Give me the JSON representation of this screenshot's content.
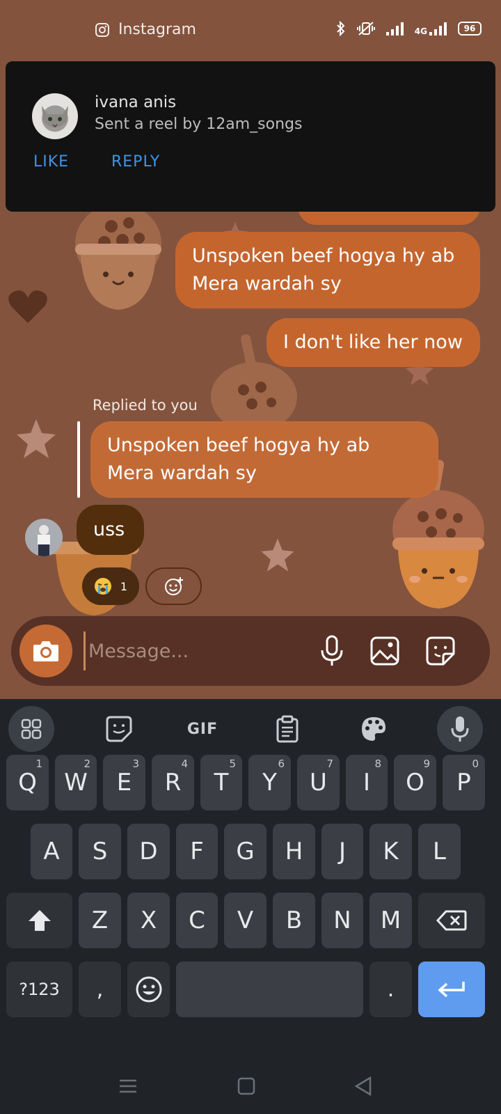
{
  "status_bar": {
    "app_name": "Instagram",
    "network_label": "4G",
    "battery_level": "96"
  },
  "notification": {
    "sender_name": "ivana anis",
    "message": "Sent a reel by 12am_songs",
    "like_label": "LIKE",
    "reply_label": "REPLY"
  },
  "messages": {
    "outgoing_1": "Unspoken beef hogya hy ab Mera wardah sy",
    "outgoing_2": "I don't like her now",
    "reply_context_label": "Replied to you",
    "quoted_message": "Unspoken beef hogya hy ab Mera wardah sy",
    "incoming_1": "uss",
    "reaction_count": "1"
  },
  "composer": {
    "placeholder": "Message..."
  },
  "keyboard": {
    "gif_label": "GIF",
    "row1": [
      {
        "key": "Q",
        "hint": "1"
      },
      {
        "key": "W",
        "hint": "2"
      },
      {
        "key": "E",
        "hint": "3"
      },
      {
        "key": "R",
        "hint": "4"
      },
      {
        "key": "T",
        "hint": "5"
      },
      {
        "key": "Y",
        "hint": "6"
      },
      {
        "key": "U",
        "hint": "7"
      },
      {
        "key": "I",
        "hint": "8"
      },
      {
        "key": "O",
        "hint": "9"
      },
      {
        "key": "P",
        "hint": "0"
      }
    ],
    "row2": [
      "A",
      "S",
      "D",
      "F",
      "G",
      "H",
      "J",
      "K",
      "L"
    ],
    "row3": [
      "Z",
      "X",
      "C",
      "V",
      "B",
      "N",
      "M"
    ],
    "symbols_label": "?123",
    "comma_label": ",",
    "period_label": "."
  },
  "colors": {
    "chat_background": "#83533e",
    "outgoing_bubble": "#c5652e",
    "incoming_bubble": "#522e0c",
    "link_blue": "#3e95e8",
    "enter_key": "#5f9cf0"
  }
}
